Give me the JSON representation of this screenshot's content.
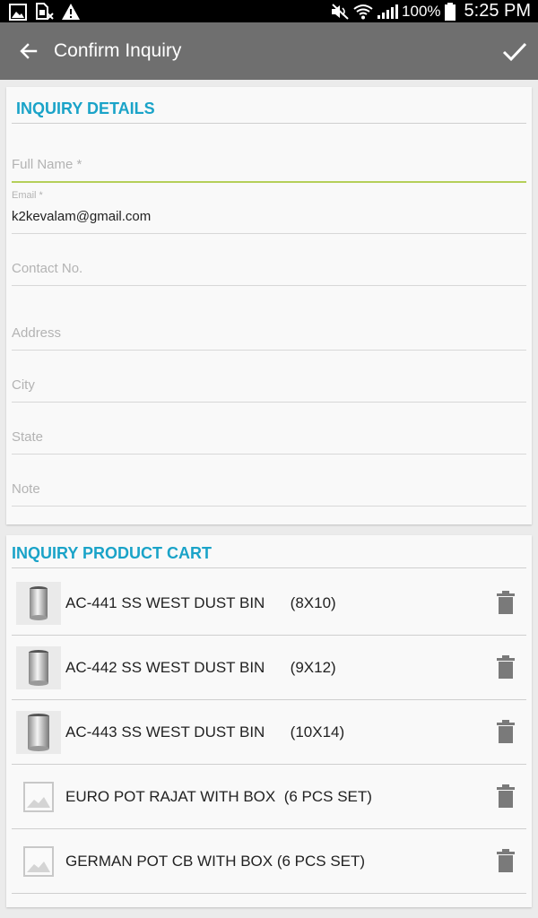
{
  "status_bar": {
    "battery": "100%",
    "time": "5:25 PM",
    "icons": [
      "gallery-icon",
      "sim-x-icon",
      "warning-icon",
      "mute-icon",
      "wifi-icon",
      "signal-icon",
      "battery-icon"
    ]
  },
  "app_bar": {
    "title": "Confirm Inquiry",
    "back_icon": "arrow-left-icon",
    "confirm_icon": "check-icon",
    "color": "#6f6f6f"
  },
  "details": {
    "title": "INQUIRY DETAILS",
    "accent": "#1aa3c8",
    "fields": {
      "full_name": {
        "placeholder": "Full Name *",
        "value": ""
      },
      "email": {
        "label": "Email *",
        "value": "k2kevalam@gmail.com"
      },
      "contact": {
        "placeholder": "Contact No.",
        "value": ""
      },
      "address": {
        "placeholder": "Address",
        "value": ""
      },
      "city": {
        "placeholder": "City",
        "value": ""
      },
      "state": {
        "placeholder": "State",
        "value": ""
      },
      "note": {
        "placeholder": "Note",
        "value": ""
      }
    }
  },
  "cart": {
    "title": "INQUIRY PRODUCT CART",
    "items": [
      {
        "label": "AC-441 SS WEST DUST BIN      (8X10)",
        "thumb": "dustbin"
      },
      {
        "label": "AC-442 SS WEST DUST BIN      (9X12)",
        "thumb": "dustbin"
      },
      {
        "label": "AC-443 SS WEST DUST BIN      (10X14)",
        "thumb": "dustbin"
      },
      {
        "label": "EURO POT RAJAT WITH BOX  (6 PCS SET)",
        "thumb": "placeholder"
      },
      {
        "label": "GERMAN POT CB WITH BOX (6 PCS SET)",
        "thumb": "placeholder"
      }
    ]
  }
}
